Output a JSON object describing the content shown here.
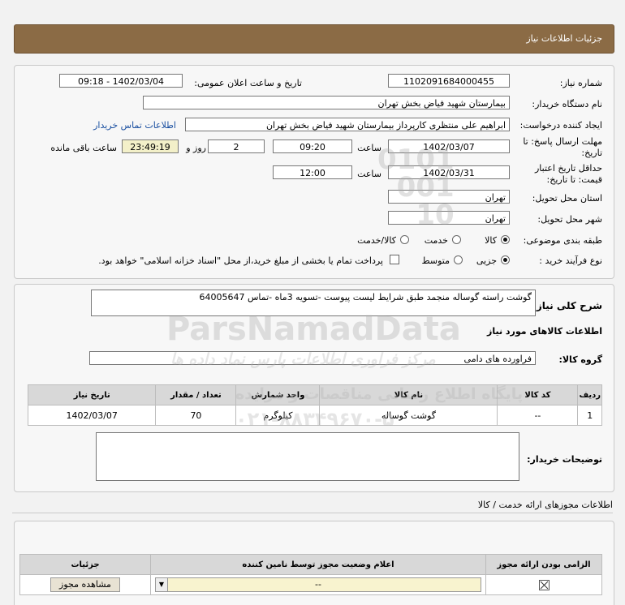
{
  "header": {
    "title": "جزئیات اطلاعات نیاز"
  },
  "form": {
    "need_number_label": "شماره نیاز:",
    "need_number": "1102091684000455",
    "announce_label": "تاریخ و ساعت اعلان عمومی:",
    "announce_value": "1402/03/04 - 09:18",
    "buyer_org_label": "نام دستگاه خریدار:",
    "buyer_org": "بیمارستان شهید فیاض بخش تهران",
    "creator_label": "ایجاد کننده درخواست:",
    "creator": "ابراهیم علی منتظری کارپرداز بیمارستان شهید فیاض بخش تهران",
    "contact_link": "اطلاعات تماس خریدار",
    "deadline_label_1": "مهلت ارسال پاسخ: تا",
    "deadline_label_2": "تاریخ:",
    "deadline_date": "1402/03/07",
    "time_word": "ساعت",
    "deadline_time": "09:20",
    "days_value": "2",
    "days_word": "روز و",
    "remaining_value": "23:49:19",
    "remaining_word": "ساعت باقی مانده",
    "validity_label_1": "حداقل تاریخ اعتبار",
    "validity_label_2": "قیمت: تا تاریخ:",
    "validity_date": "1402/03/31",
    "validity_time": "12:00",
    "province_label": "استان محل تحویل:",
    "province": "تهران",
    "city_label": "شهر محل تحویل:",
    "city": "تهران",
    "category_label": "طبقه بندی موضوعی:",
    "category_options": [
      "کالا",
      "خدمت",
      "کالا/خدمت"
    ],
    "category_selected": "کالا",
    "process_label": "نوع فرآیند خرید :",
    "process_options": [
      "جزیی",
      "متوسط"
    ],
    "process_selected": "جزیی",
    "payment_note": "پرداخت تمام یا بخشی از مبلغ خرید،از محل \"اسناد خزانه اسلامی\" خواهد بود."
  },
  "summary": {
    "label": "شرح کلی نیاز:",
    "text": "گوشت راسته گوساله منجمد طبق شرایط لیست پیوست -تسویه 3ماه -تماس 64005647"
  },
  "goods": {
    "section_title": "اطلاعات کالاهای مورد نیاز",
    "group_label": "گروه کالا:",
    "group_value": "فراورده های دامی",
    "columns": [
      "ردیف",
      "کد کالا",
      "نام کالا",
      "واحد شمارش",
      "تعداد / مقدار",
      "تاریخ نیاز"
    ],
    "rows": [
      [
        "1",
        "--",
        "گوشت گوساله",
        "کیلوگرم",
        "70",
        "1402/03/07"
      ]
    ],
    "buyer_notes_label": "توضیحات خریدار:"
  },
  "permits": {
    "title": "اطلاعات مجوزهای ارائه خدمت / کالا",
    "columns": [
      "الزامی بودن ارائه مجوز",
      "اعلام وضعیت مجوز توسط نامین کننده",
      "جزئیات"
    ],
    "status_value": "--",
    "view_button": "مشاهده مجوز"
  },
  "watermark": {
    "line1": "ParsNamadData",
    "line2": "مرکز فراوری اطلاعات پارس نماد داده ها",
    "line3": "پایگاه اطلاع رسانی مناقصات و مزایده",
    "phone": "۰۲۱-۸۸۳۴۹۶۷۰-۵"
  },
  "colors": {
    "header_bg": "#8b6b45",
    "link": "#1a4fa0",
    "remaining_bg": "#f3f0c9"
  }
}
